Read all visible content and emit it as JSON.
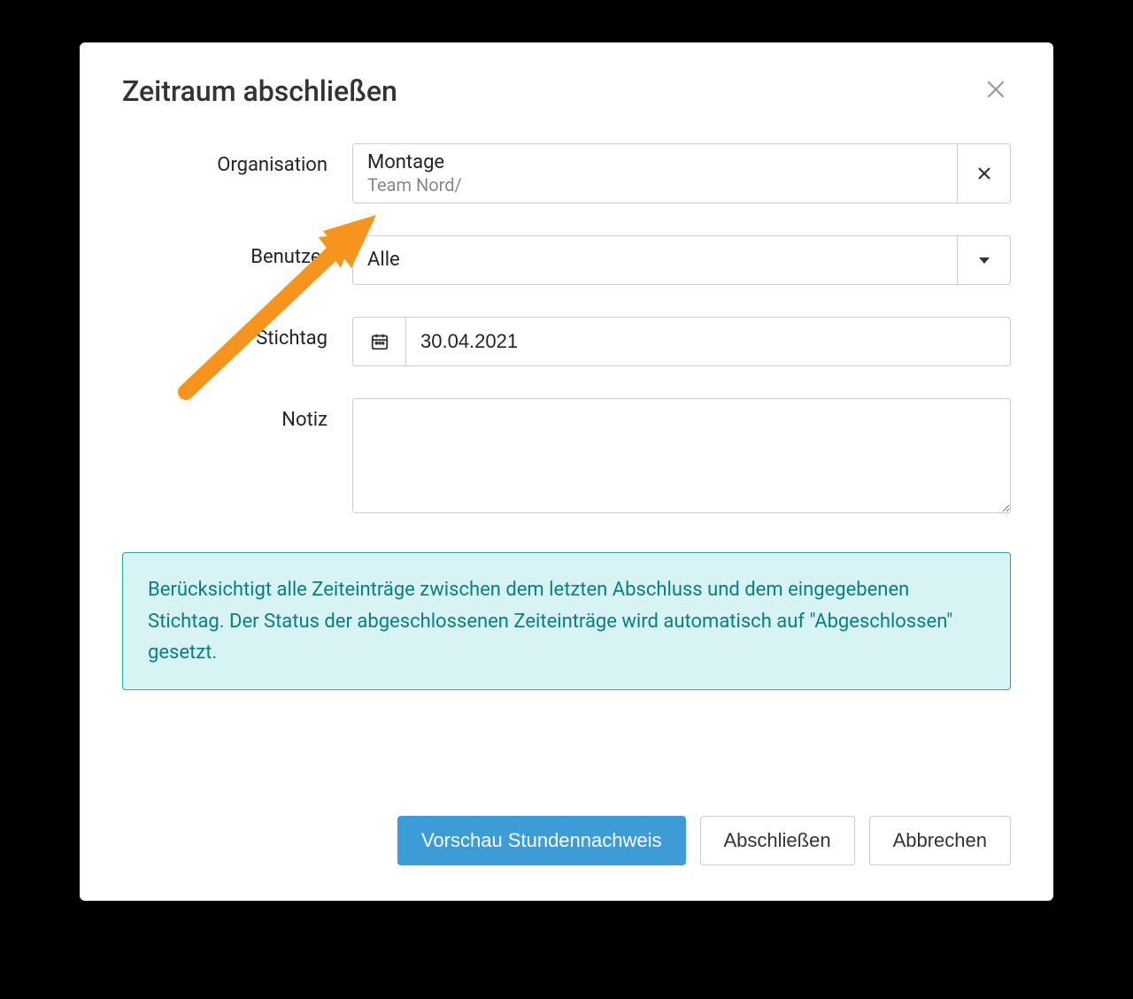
{
  "dialog": {
    "title": "Zeitraum abschließen"
  },
  "form": {
    "organisation": {
      "label": "Organisation",
      "value": "Montage",
      "subvalue": "Team Nord/"
    },
    "benutzer": {
      "label": "Benutzer",
      "value": "Alle"
    },
    "stichtag": {
      "label": "Stichtag",
      "value": "30.04.2021"
    },
    "notiz": {
      "label": "Notiz",
      "value": ""
    }
  },
  "info_text": "Berücksichtigt alle Zeiteinträge zwischen dem letzten Abschluss und dem eingegebenen Stichtag. Der Status der abgeschlossenen Zeiteinträge wird automatisch auf \"Abgeschlossen\" gesetzt.",
  "buttons": {
    "preview": "Vorschau Stundennachweis",
    "submit": "Abschließen",
    "cancel": "Abbrechen"
  },
  "colors": {
    "primary": "#3d9cd6",
    "info_bg": "#d7f3f3",
    "info_border": "#2aa6a6",
    "info_text": "#0a7e82",
    "arrow": "#f7941d"
  }
}
